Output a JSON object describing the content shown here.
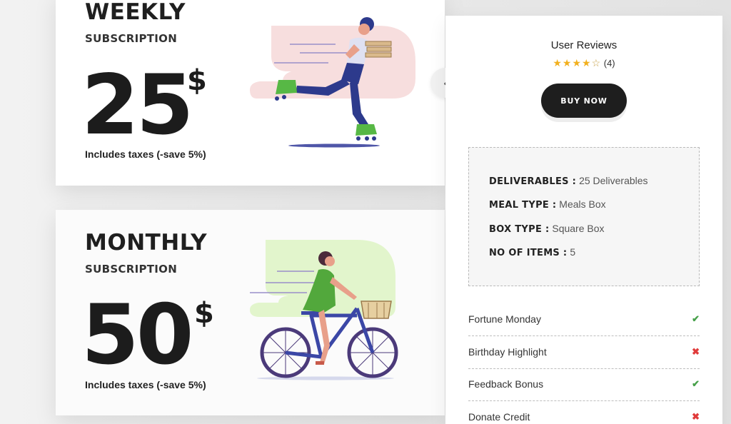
{
  "plans": [
    {
      "title": "WEEKLY",
      "subtitle": "SUBSCRIPTION",
      "price": "25",
      "currency": "$",
      "note": "Includes taxes (-save 5%)"
    },
    {
      "title": "MONTHLY",
      "subtitle": "SUBSCRIPTION",
      "price": "50",
      "currency": "$",
      "note": "Includes taxes (-save 5%)"
    }
  ],
  "nav": {
    "prev_glyph": "‹"
  },
  "reviews": {
    "title": "User Reviews",
    "stars_filled": "★★★★",
    "stars_empty": "☆",
    "count": "(4)",
    "rating": 4,
    "star_color": "#f2b01e"
  },
  "buy_button": {
    "label": "BUY NOW"
  },
  "specs": [
    {
      "key": "DELIVERABLES :",
      "value": "25 Deliverables"
    },
    {
      "key": "MEAL TYPE :",
      "value": "Meals Box"
    },
    {
      "key": "BOX TYPE :",
      "value": "Square Box"
    },
    {
      "key": "NO OF ITEMS :",
      "value": "5"
    }
  ],
  "features": [
    {
      "label": "Fortune Monday",
      "mark": "✔",
      "included": true
    },
    {
      "label": "Birthday Highlight",
      "mark": "✖",
      "included": false
    },
    {
      "label": "Feedback Bonus",
      "mark": "✔",
      "included": true
    },
    {
      "label": "Donate Credit",
      "mark": "✖",
      "included": false
    }
  ],
  "colors": {
    "check": "#46a049",
    "cross": "#e03b3b",
    "button": "#1e1e1e"
  }
}
